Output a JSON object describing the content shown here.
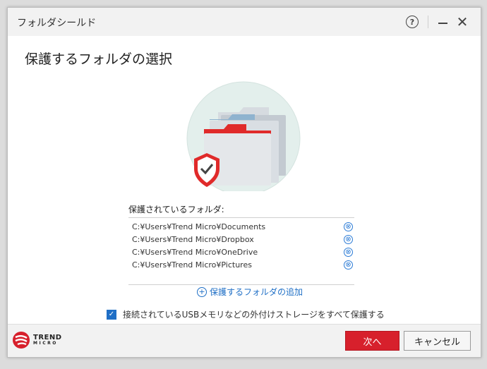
{
  "window": {
    "title": "フォルダシールド",
    "help_label": "?",
    "close_label": "✕"
  },
  "heading": "保護するフォルダの選択",
  "protected": {
    "label": "保護されているフォルダ:",
    "folders": [
      "C:¥Users¥Trend Micro¥Documents",
      "C:¥Users¥Trend Micro¥Dropbox",
      "C:¥Users¥Trend Micro¥OneDrive",
      "C:¥Users¥Trend Micro¥Pictures"
    ],
    "remove_icon": "⊗"
  },
  "add_folder": {
    "icon": "+",
    "label": "保護するフォルダの追加"
  },
  "usb_option": {
    "checked": true,
    "check_glyph": "✓",
    "label": "接続されているUSBメモリなどの外付けストレージをすべて保護する"
  },
  "logo": {
    "line1": "TREND",
    "line2": "MICRO"
  },
  "buttons": {
    "next": "次へ",
    "cancel": "キャンセル"
  },
  "colors": {
    "accent_red": "#d7202c",
    "link_blue": "#1f6fc6"
  }
}
